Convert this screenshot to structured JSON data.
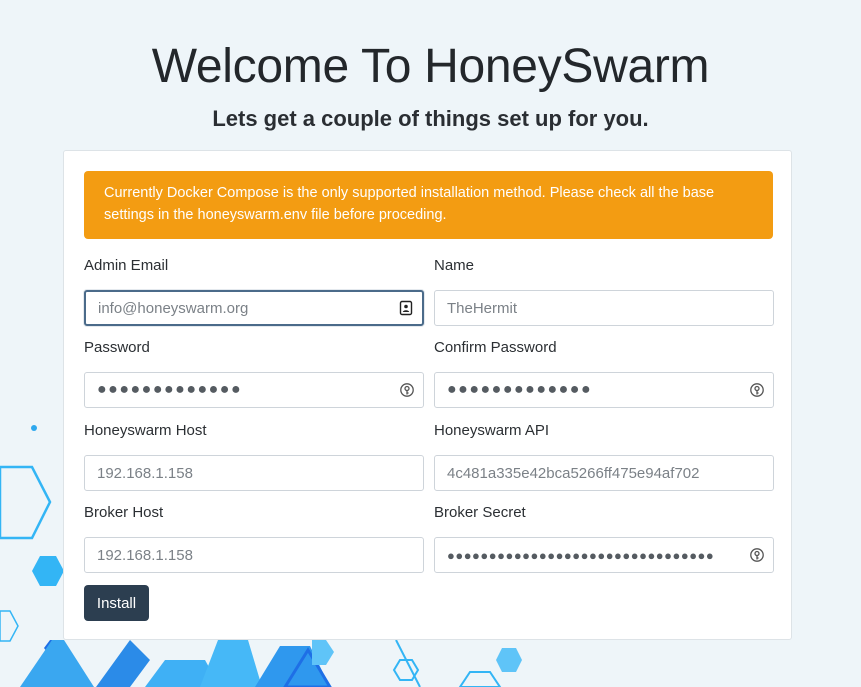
{
  "header": {
    "title": "Welcome To HoneySwarm",
    "subtitle": "Lets get a couple of things set up for you."
  },
  "alert": {
    "text": "Currently Docker Compose is the only supported installation method. Please check all the base settings in the honeyswarm.env file before proceding.",
    "color": "#f39c12"
  },
  "form": {
    "admin_email": {
      "label": "Admin Email",
      "placeholder": "info@honeyswarm.org",
      "value": "",
      "icon": "contact-card-icon"
    },
    "name": {
      "label": "Name",
      "placeholder": "TheHermit",
      "value": ""
    },
    "password": {
      "label": "Password",
      "value": "●●●●●●●●●●●●●",
      "icon": "key-icon"
    },
    "confirm_password": {
      "label": "Confirm Password",
      "value": "●●●●●●●●●●●●●",
      "icon": "key-icon"
    },
    "honeyswarm_host": {
      "label": "Honeyswarm Host",
      "placeholder": "192.168.1.158",
      "value": ""
    },
    "honeyswarm_api": {
      "label": "Honeyswarm API",
      "placeholder": "4c481a335e42bca5266ff475e94af702",
      "value": ""
    },
    "broker_host": {
      "label": "Broker Host",
      "placeholder": "192.168.1.158",
      "value": ""
    },
    "broker_secret": {
      "label": "Broker Secret",
      "value": "●●●●●●●●●●●●●●●●●●●●●●●●●●●●●●●●",
      "icon": "key-icon"
    },
    "install_label": "Install"
  },
  "colors": {
    "background": "#eef5f9",
    "button": "#2c3e50",
    "hexagon_accent": "#2ea8ee"
  }
}
